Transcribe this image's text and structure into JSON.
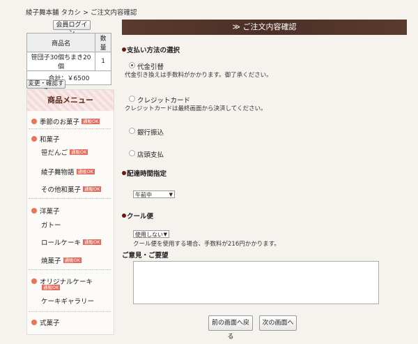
{
  "breadcrumb": "綾子舞本舗 タカシ > ご注文内容確認",
  "login_label": "会員ログイン",
  "cart": {
    "headers": [
      "商品名",
      "数量"
    ],
    "item_name": "笹団子30個ちまき20個",
    "item_qty": "1",
    "total": "合計：￥6500"
  },
  "edit_label": "変更・確認する",
  "menu": {
    "title": "商品メニュー",
    "badge": "通販OK",
    "items": [
      "季節のお菓子",
      "和菓子",
      "笹だんご",
      "綾子舞物語",
      "その他和菓子",
      "洋菓子",
      "ガトー",
      "ロールケーキ",
      "焼菓子",
      "オリジナルケーキ",
      "ケーキギャラリー",
      "式菓子"
    ]
  },
  "title": "≫ ご注文内容確認",
  "payment": {
    "heading": "支払い方法の選択",
    "options": [
      "代金引替",
      "クレジットカード",
      "銀行振込",
      "店頭支払"
    ],
    "notes": [
      "代金引き換えは手数料がかかります。御了承ください。",
      "クレジットカードは最終画面から決済してください。"
    ]
  },
  "delivery": {
    "heading": "配達時間指定",
    "value": "午前中"
  },
  "cool": {
    "heading": "クール便",
    "value": "使用しない",
    "note": "クール便を使用する場合、手数料が216円かかります。"
  },
  "comment_heading": "ご意見・ご要望",
  "back_label": "前の画面へ戻る",
  "next_label": "次の画面へ"
}
